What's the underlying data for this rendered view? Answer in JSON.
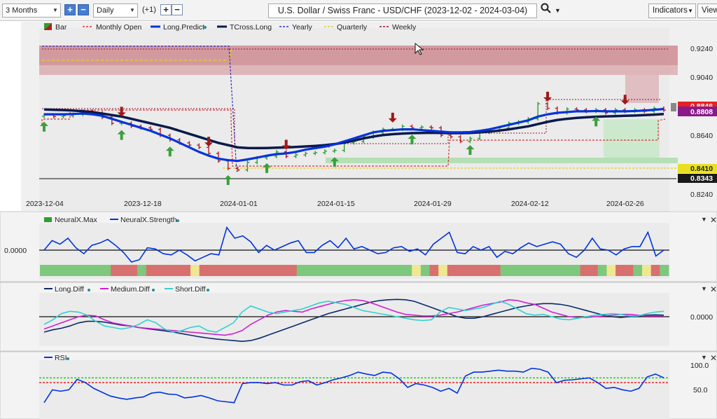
{
  "toolbar": {
    "period": "3 Months",
    "interval": "Daily",
    "offset": "(+1)",
    "title": "U.S. Dollar / Swiss Franc - USD/CHF (2023-12-02 - 2024-03-04)",
    "indicators": "Indicators",
    "view": "View"
  },
  "legend": {
    "bar": "Bar",
    "monthly_open": "Monthly Open",
    "long_predict": "Long.Predict",
    "tcross_long": "TCross.Long",
    "yearly": "Yearly",
    "quarterly": "Quarterly",
    "weekly": "Weekly"
  },
  "colors": {
    "up_bar": "#2e9e2e",
    "down_bar": "#b02020",
    "long_predict": "#0033dd",
    "tcross_long": "#0a1a4a",
    "monthly_open": "#e03030",
    "yearly": "#3030c0",
    "quarterly": "#e0d020",
    "weekly": "#9a1030",
    "upper_band": "#d9a0a5",
    "lower_band": "#a8dca8"
  },
  "price_axis": {
    "ticks": [
      "0.9240",
      "0.9040",
      "0.8846",
      "0.8640",
      "0.8410",
      "0.8343",
      "0.8240"
    ],
    "current": "0.8808",
    "last_red": "0.8846",
    "level_yellow": "0.8410",
    "level_black": "0.8343"
  },
  "date_axis": [
    "2023-12-04",
    "2023-12-18",
    "2024-01-01",
    "2024-01-15",
    "2024-01-29",
    "2024-02-12",
    "2024-02-26"
  ],
  "panels": {
    "neuralx": {
      "max_label": "NeuralX.Max",
      "strength_label": "NeuralX.Strength",
      "axis": "0.0000"
    },
    "diff": {
      "long_label": "Long.Diff",
      "medium_label": "Medium.Diff",
      "short_label": "Short.Diff",
      "axis": "0.0000"
    },
    "rsi": {
      "label": "RSI",
      "ticks": [
        "100.0",
        "50.0"
      ]
    }
  },
  "chart_data": [
    {
      "type": "candlestick",
      "x": [
        "2023-12-04",
        "2023-12-05",
        "2023-12-06",
        "2023-12-07",
        "2023-12-08",
        "2023-12-11",
        "2023-12-12",
        "2023-12-13",
        "2023-12-14",
        "2023-12-15",
        "2023-12-18",
        "2023-12-19",
        "2023-12-20",
        "2023-12-21",
        "2023-12-22",
        "2023-12-25",
        "2023-12-26",
        "2023-12-27",
        "2023-12-28",
        "2023-12-29",
        "2024-01-01",
        "2024-01-02",
        "2024-01-03",
        "2024-01-04",
        "2024-01-05",
        "2024-01-08",
        "2024-01-09",
        "2024-01-10",
        "2024-01-11",
        "2024-01-12",
        "2024-01-15",
        "2024-01-16",
        "2024-01-17",
        "2024-01-18",
        "2024-01-19",
        "2024-01-22",
        "2024-01-23",
        "2024-01-24",
        "2024-01-25",
        "2024-01-26",
        "2024-01-29",
        "2024-01-30",
        "2024-01-31",
        "2024-02-01",
        "2024-02-02",
        "2024-02-05",
        "2024-02-06",
        "2024-02-07",
        "2024-02-08",
        "2024-02-09",
        "2024-02-12",
        "2024-02-13",
        "2024-02-14",
        "2024-02-15",
        "2024-02-16",
        "2024-02-19",
        "2024-02-20",
        "2024-02-21",
        "2024-02-22",
        "2024-02-23",
        "2024-02-26",
        "2024-02-27",
        "2024-02-28",
        "2024-02-29",
        "2024-03-01"
      ],
      "close": [
        0.8775,
        0.8765,
        0.877,
        0.878,
        0.88,
        0.879,
        0.876,
        0.872,
        0.872,
        0.87,
        0.869,
        0.868,
        0.864,
        0.861,
        0.859,
        0.8575,
        0.856,
        0.852,
        0.847,
        0.842,
        0.841,
        0.846,
        0.849,
        0.85,
        0.853,
        0.85,
        0.851,
        0.852,
        0.8525,
        0.8535,
        0.854,
        0.859,
        0.86,
        0.863,
        0.866,
        0.868,
        0.868,
        0.87,
        0.869,
        0.8695,
        0.869,
        0.864,
        0.863,
        0.86,
        0.862,
        0.866,
        0.867,
        0.869,
        0.872,
        0.873,
        0.875,
        0.885,
        0.882,
        0.879,
        0.8815,
        0.881,
        0.88,
        0.881,
        0.879,
        0.881,
        0.88,
        0.881,
        0.88,
        0.882,
        0.8808
      ],
      "ylim": [
        0.824,
        0.927
      ]
    },
    {
      "type": "line",
      "series": [
        {
          "name": "NeuralX.Strength"
        }
      ],
      "axis_label": "0.0000"
    },
    {
      "type": "line",
      "series": [
        {
          "name": "Long.Diff"
        },
        {
          "name": "Medium.Diff"
        },
        {
          "name": "Short.Diff"
        }
      ],
      "axis_label": "0.0000"
    },
    {
      "type": "line",
      "series": [
        {
          "name": "RSI"
        }
      ],
      "ylim": [
        0,
        110
      ],
      "levels": [
        70,
        60
      ]
    }
  ],
  "series_values": {
    "long_predict": [
      0.878,
      0.878,
      0.878,
      0.8782,
      0.8785,
      0.878,
      0.877,
      0.875,
      0.873,
      0.871,
      0.869,
      0.867,
      0.8645,
      0.862,
      0.859,
      0.856,
      0.853,
      0.8505,
      0.8485,
      0.8475,
      0.847,
      0.848,
      0.8492,
      0.8505,
      0.8515,
      0.852,
      0.853,
      0.8545,
      0.8555,
      0.8565,
      0.858,
      0.86,
      0.862,
      0.864,
      0.866,
      0.867,
      0.8675,
      0.868,
      0.868,
      0.8675,
      0.867,
      0.8665,
      0.866,
      0.866,
      0.8662,
      0.867,
      0.868,
      0.8695,
      0.871,
      0.8725,
      0.874,
      0.8765,
      0.878,
      0.879,
      0.8795,
      0.88,
      0.88,
      0.8802,
      0.88,
      0.88,
      0.88,
      0.8802,
      0.8805,
      0.881,
      0.8815
    ],
    "tcross_long": [
      0.8812,
      0.881,
      0.8808,
      0.8805,
      0.88,
      0.8795,
      0.8785,
      0.8775,
      0.8765,
      0.875,
      0.8735,
      0.872,
      0.8705,
      0.869,
      0.867,
      0.865,
      0.863,
      0.861,
      0.859,
      0.8575,
      0.856,
      0.8556,
      0.8555,
      0.8556,
      0.8558,
      0.856,
      0.8563,
      0.8566,
      0.857,
      0.8575,
      0.8582,
      0.8592,
      0.8605,
      0.862,
      0.8632,
      0.8642,
      0.8648,
      0.8652,
      0.8655,
      0.8656,
      0.8657,
      0.8656,
      0.8655,
      0.8655,
      0.8656,
      0.866,
      0.8665,
      0.8672,
      0.868,
      0.869,
      0.87,
      0.8715,
      0.873,
      0.8742,
      0.875,
      0.8756,
      0.876,
      0.8764,
      0.8766,
      0.8768,
      0.877,
      0.8772,
      0.8775,
      0.8778,
      0.8782
    ],
    "neuralx_strength": [
      0.0,
      0.8,
      0.5,
      1.0,
      0.2,
      -0.3,
      0.4,
      0.6,
      0.9,
      0.4,
      -0.2,
      -1.0,
      -0.8,
      0.2,
      0.1,
      -0.3,
      -0.4,
      0.0,
      -0.4,
      -0.9,
      -0.6,
      -0.3,
      -0.4,
      1.9,
      1.0,
      1.2,
      0.7,
      -0.2,
      0.4,
      0.0,
      0.3,
      0.6,
      0.8,
      -0.2,
      -0.2,
      0.4,
      0.8,
      0.2,
      1.0,
      0.1,
      0.3,
      0.0,
      -0.3,
      -0.2,
      0.2,
      0.3,
      -0.1,
      0.1,
      -0.4,
      0.5,
      1.0,
      1.5,
      -0.2,
      -0.3,
      0.3,
      0.0,
      0.3,
      -0.6,
      -0.1,
      -0.3,
      0.2,
      0.6,
      0.3,
      0.5,
      0.7,
      0.5,
      -0.3,
      -0.6,
      0.0,
      1.0,
      0.1,
      0.0,
      -0.4,
      0.1,
      0.3,
      0.3,
      1.5,
      -0.5,
      0.0
    ],
    "long_diff": [
      -1.0,
      -0.85,
      -0.75,
      -0.6,
      -0.4,
      -0.3,
      -0.3,
      -0.35,
      -0.45,
      -0.55,
      -0.6,
      -0.7,
      -0.78,
      -0.85,
      -0.92,
      -1.0,
      -1.1,
      -1.2,
      -1.3,
      -1.38,
      -1.45,
      -1.5,
      -1.55,
      -1.6,
      -1.55,
      -1.4,
      -1.2,
      -1.0,
      -0.8,
      -0.6,
      -0.4,
      -0.2,
      0.0,
      0.2,
      0.35,
      0.5,
      0.65,
      0.8,
      0.95,
      1.05,
      1.1,
      1.12,
      1.1,
      1.0,
      0.8,
      0.6,
      0.4,
      0.2,
      0.0,
      -0.1,
      -0.1,
      0.0,
      0.15,
      0.3,
      0.45,
      0.6,
      0.7,
      0.8,
      0.85,
      0.85,
      0.8,
      0.7,
      0.55,
      0.4,
      0.25,
      0.1,
      0.0,
      -0.05,
      0.0,
      0.05,
      0.1,
      0.12,
      0.1
    ],
    "medium_diff": [
      -0.8,
      -0.6,
      -0.4,
      -0.2,
      0.0,
      0.1,
      0.05,
      -0.2,
      -0.4,
      -0.5,
      -0.6,
      -0.7,
      -0.75,
      -0.8,
      -0.85,
      -0.9,
      -0.95,
      -1.0,
      -1.05,
      -1.1,
      -1.15,
      -1.2,
      -1.1,
      -0.9,
      -0.5,
      -0.2,
      0.1,
      0.3,
      0.4,
      0.35,
      0.3,
      0.5,
      0.65,
      0.8,
      0.95,
      1.05,
      1.1,
      1.05,
      0.9,
      0.7,
      0.5,
      0.3,
      0.15,
      0.1,
      0.05,
      0.05,
      0.1,
      0.2,
      0.3,
      0.45,
      0.6,
      0.75,
      0.85,
      0.95,
      1.1,
      1.05,
      0.9,
      0.8,
      0.55,
      0.3,
      0.15,
      0.0,
      -0.05,
      -0.05,
      0.0,
      0.05,
      0.1,
      0.15,
      0.15,
      0.1,
      0.05,
      0.05,
      0.05
    ],
    "short_diff": [
      -0.5,
      -0.2,
      0.2,
      0.35,
      0.3,
      0.1,
      -0.3,
      -0.6,
      -0.7,
      -0.8,
      -0.7,
      -0.5,
      -0.2,
      -0.4,
      -0.8,
      -1.0,
      -0.9,
      -0.7,
      -0.6,
      -0.9,
      -1.0,
      -0.7,
      -0.4,
      0.3,
      0.7,
      0.5,
      0.3,
      0.2,
      0.3,
      0.4,
      0.5,
      0.7,
      0.9,
      1.0,
      0.9,
      0.8,
      0.6,
      0.4,
      0.3,
      0.2,
      0.1,
      0.0,
      -0.1,
      -0.2,
      -0.25,
      -0.2,
      0.3,
      0.6,
      0.5,
      0.4,
      0.5,
      0.6,
      0.8,
      1.0,
      0.8,
      0.5,
      0.2,
      0.1,
      0.15,
      0.0,
      -0.15,
      -0.2,
      -0.1,
      0.0,
      0.1,
      0.15,
      0.2,
      0.15,
      0.05,
      0.05,
      0.2,
      0.3,
      0.35
    ],
    "rsi": [
      18,
      45,
      42,
      45,
      67,
      60,
      48,
      40,
      32,
      28,
      25,
      28,
      30,
      38,
      40,
      36,
      35,
      28,
      30,
      33,
      28,
      22,
      20,
      18,
      58,
      60,
      60,
      58,
      60,
      55,
      55,
      62,
      64,
      55,
      60,
      66,
      70,
      75,
      82,
      78,
      75,
      82,
      80,
      68,
      50,
      58,
      55,
      50,
      42,
      48,
      38,
      74,
      82,
      82,
      84,
      86,
      84,
      84,
      82,
      90,
      88,
      82,
      60,
      65,
      66,
      68,
      70,
      60,
      48,
      50,
      45,
      42,
      48,
      72,
      78,
      70
    ],
    "neuralx_bars": [
      "g",
      "g",
      "g",
      "g",
      "g",
      "g",
      "g",
      "g",
      "r",
      "r",
      "r",
      "g",
      "r",
      "r",
      "r",
      "r",
      "r",
      "y",
      "r",
      "r",
      "r",
      "r",
      "r",
      "r",
      "r",
      "r",
      "r",
      "r",
      "r",
      "g",
      "g",
      "g",
      "g",
      "g",
      "g",
      "g",
      "g",
      "g",
      "g",
      "g",
      "g",
      "g",
      "y",
      "g",
      "r",
      "y",
      "r",
      "r",
      "r",
      "r",
      "r",
      "r",
      "g",
      "g",
      "g",
      "g",
      "g",
      "g",
      "g",
      "g",
      "g",
      "r",
      "r",
      "g",
      "y",
      "r",
      "r",
      "g",
      "y",
      "r",
      "g"
    ]
  }
}
